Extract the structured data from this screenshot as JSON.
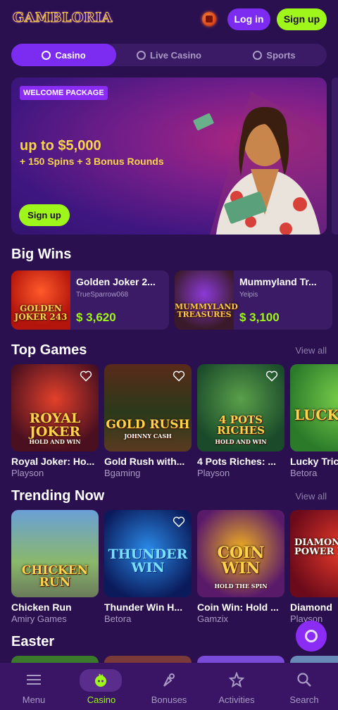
{
  "header": {
    "logo": "GAMBLORIA",
    "login_label": "Log in",
    "signup_label": "Sign up"
  },
  "tabs": [
    {
      "label": "Casino",
      "active": true
    },
    {
      "label": "Live Casino",
      "active": false
    },
    {
      "label": "Sports",
      "active": false
    }
  ],
  "promo": {
    "badge": "WELCOME PACKAGE",
    "title": "up to $5,000",
    "subtitle": "+ 150 Spins + 3 Bonus Rounds",
    "cta": "Sign up"
  },
  "big_wins": {
    "title": "Big Wins",
    "items": [
      {
        "game": "Golden Joker 2...",
        "user": "TrueSparrow068",
        "amount": "$ 3,620",
        "thumb_text": "GOLDEN JOKER 243"
      },
      {
        "game": "Mummyland Tr...",
        "user": "Yeipis",
        "amount": "$ 3,100",
        "thumb_text": "MUMMYLAND TREASURES"
      }
    ]
  },
  "top_games": {
    "title": "Top Games",
    "view_all": "View all",
    "items": [
      {
        "name": "Royal Joker: Ho...",
        "provider": "Playson",
        "thumb_text": "ROYAL JOKER",
        "thumb_sub": "HOLD AND WIN"
      },
      {
        "name": "Gold Rush with...",
        "provider": "Bgaming",
        "thumb_text": "GOLD RUSH",
        "thumb_sub": "JOHNNY CASH"
      },
      {
        "name": "4 Pots Riches: ...",
        "provider": "Playson",
        "thumb_text": "4 POTS RICHES",
        "thumb_sub": "HOLD AND WIN"
      },
      {
        "name": "Lucky Tric",
        "provider": "Betora",
        "thumb_text": "LUCKY TR",
        "thumb_sub": ""
      }
    ]
  },
  "trending": {
    "title": "Trending Now",
    "view_all": "View all",
    "items": [
      {
        "name": "Chicken Run",
        "provider": "Amiry Games",
        "thumb_text": "CHICKEN RUN",
        "thumb_sub": ""
      },
      {
        "name": "Thunder Win H...",
        "provider": "Betora",
        "thumb_text": "THUNDER WIN",
        "thumb_sub": ""
      },
      {
        "name": "Coin Win: Hold ...",
        "provider": "Gamzix",
        "thumb_text": "COIN WIN",
        "thumb_sub": "HOLD THE SPIN"
      },
      {
        "name": "Diamond",
        "provider": "Playson",
        "thumb_text": "DIAMOND POWER XXL",
        "thumb_sub": "HOLD AND WIN"
      }
    ]
  },
  "easter": {
    "title": "Easter"
  },
  "bottom_nav": [
    {
      "label": "Menu",
      "icon": "menu-icon",
      "active": false
    },
    {
      "label": "Casino",
      "icon": "casino-icon",
      "active": true
    },
    {
      "label": "Bonuses",
      "icon": "bonuses-icon",
      "active": false
    },
    {
      "label": "Activities",
      "icon": "activities-icon",
      "active": false
    },
    {
      "label": "Search",
      "icon": "search-icon",
      "active": false
    }
  ],
  "colors": {
    "background": "#2b1050",
    "accent_purple": "#7c2cf0",
    "accent_green": "#9ff61a",
    "gold": "#f8d449"
  }
}
